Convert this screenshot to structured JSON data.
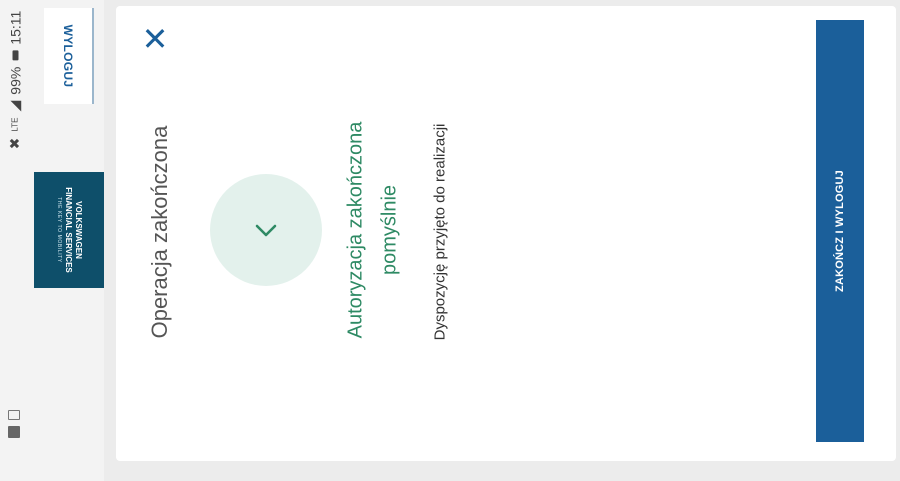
{
  "status_bar": {
    "network": "LTE",
    "battery": "99%",
    "time": "15:11"
  },
  "header": {
    "logout_label": "WYLOGUJ",
    "brand_line1": "VOLKSWAGEN",
    "brand_line2": "FINANCIAL SERVICES",
    "brand_tagline": "THE KEY TO MOBILITY"
  },
  "dialog": {
    "close_icon": "close-icon",
    "title": "Operacja zakończona",
    "success_icon": "chevron-right-icon",
    "success_line1": "Autoryzacja zakończona",
    "success_line2": "pomyślnie",
    "info": "Dyspozycję przyjęto do realizacji",
    "finish_button": "ZAKOŃCZ I WYLOGUJ"
  },
  "colors": {
    "primary": "#1b5f9a",
    "success": "#2e8a64",
    "success_bg": "#e3f1ec",
    "brand_bg": "#0e4f6a"
  }
}
